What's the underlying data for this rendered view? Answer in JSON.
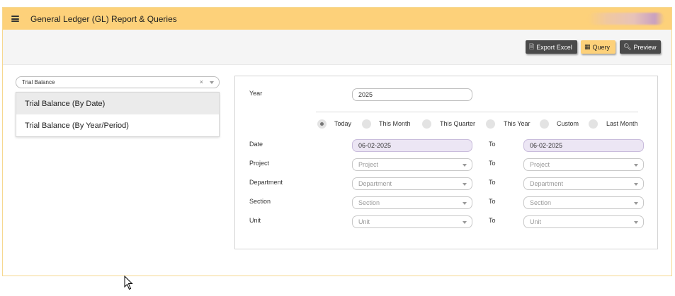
{
  "header": {
    "title": "General Ledger (GL) Report & Queries"
  },
  "toolbar": {
    "export_excel": "Export Excel",
    "query": "Query",
    "preview": "Preview"
  },
  "report": {
    "selected": "Trial Balance",
    "options": [
      "Trial Balance (By Date)",
      "Trial Balance (By Year/Period)"
    ]
  },
  "form": {
    "year_label": "Year",
    "year_value": "2025",
    "periods": [
      "Today",
      "This Month",
      "This Quarter",
      "This Year",
      "Custom",
      "Last Month"
    ],
    "selected_period": "Today",
    "to_label": "To",
    "date": {
      "label": "Date",
      "from": "06-02-2025",
      "to": "06-02-2025"
    },
    "project": {
      "label": "Project",
      "placeholder": "Project"
    },
    "department": {
      "label": "Department",
      "placeholder": "Department"
    },
    "section": {
      "label": "Section",
      "placeholder": "Section"
    },
    "unit": {
      "label": "Unit",
      "placeholder": "Unit"
    }
  },
  "icons": {
    "menu": "hamburger-icon",
    "excel": "file-excel-icon",
    "query": "table-icon",
    "preview": "search-icon"
  },
  "colors": {
    "accent": "#fdd17a",
    "dark_button": "#4a4a4a",
    "date_field": "#ece6f4"
  }
}
